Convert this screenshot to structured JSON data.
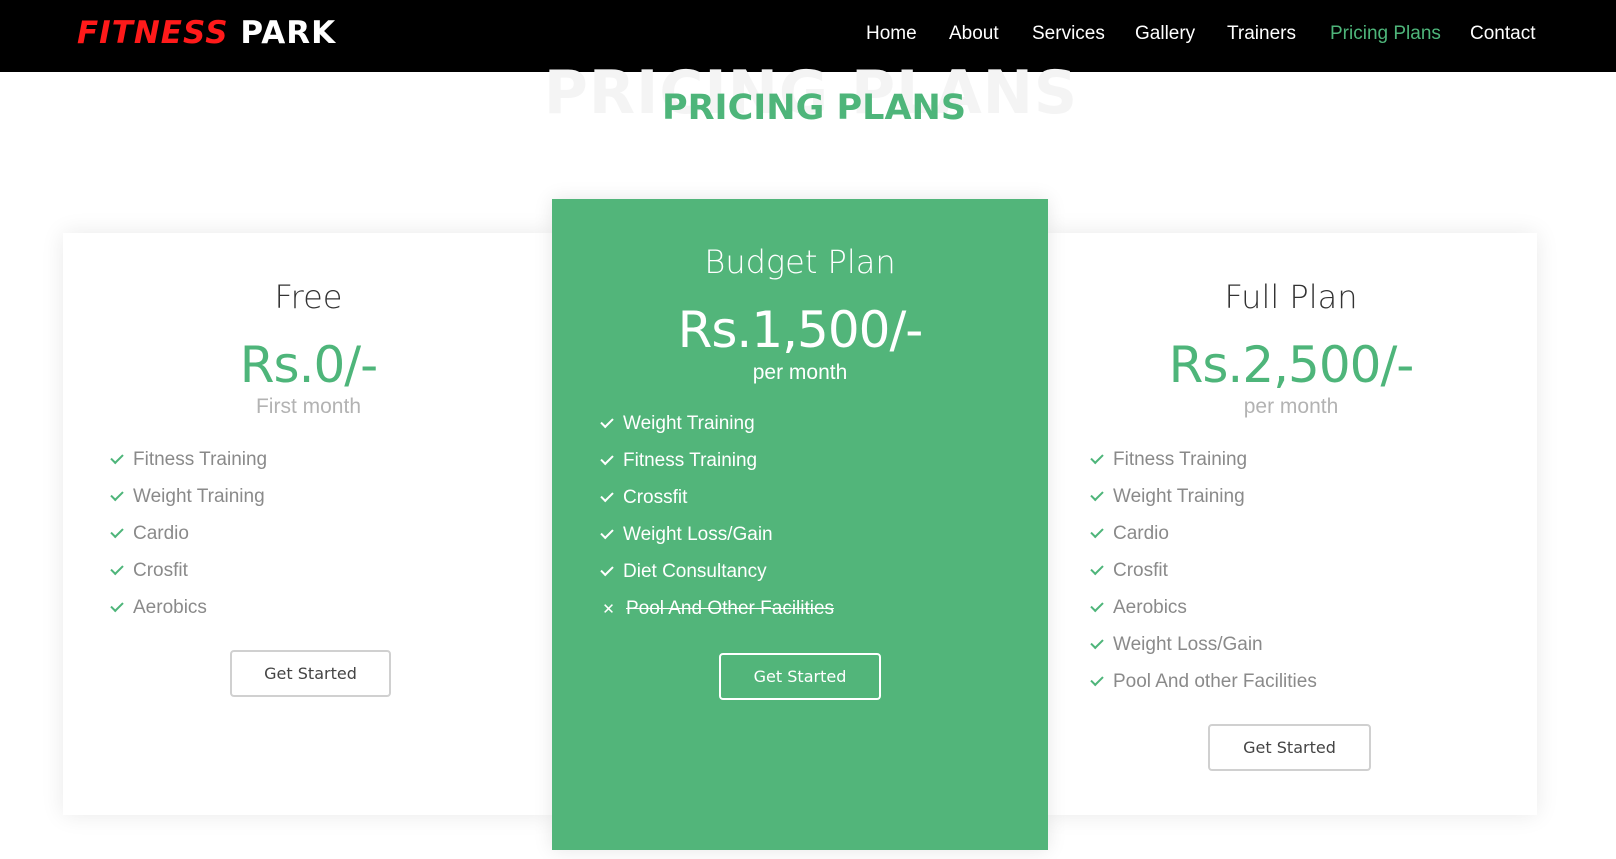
{
  "header": {
    "brand_part1": "FITNESS",
    "brand_part2": "PARK",
    "nav": [
      {
        "label": "Home"
      },
      {
        "label": "About"
      },
      {
        "label": "Services"
      },
      {
        "label": "Gallery"
      },
      {
        "label": "Trainers"
      },
      {
        "label": "Pricing Plans",
        "active": true
      },
      {
        "label": "Contact"
      }
    ]
  },
  "section": {
    "ghost_title": "PRICING PLANS",
    "title": "PRICING PLANS"
  },
  "plans": [
    {
      "name": "Free",
      "price": "Rs.0/-",
      "period": "First month",
      "features": [
        {
          "text": "Fitness Training",
          "icon": "check-icon"
        },
        {
          "text": "Weight Training",
          "icon": "check-icon"
        },
        {
          "text": "Cardio",
          "icon": "check-icon"
        },
        {
          "text": "Crosfit",
          "icon": "check-icon"
        },
        {
          "text": "Aerobics",
          "icon": "check-icon"
        }
      ],
      "button": "Get Started"
    },
    {
      "name": "Budget Plan",
      "price": "Rs.1,500/-",
      "period": "per month",
      "features": [
        {
          "text": "Weight Training",
          "icon": "check-icon"
        },
        {
          "text": "Fitness Training",
          "icon": "check-icon"
        },
        {
          "text": "Crossfit",
          "icon": "check-icon"
        },
        {
          "text": "Weight Loss/Gain",
          "icon": "check-icon"
        },
        {
          "text": "Diet Consultancy",
          "icon": "check-icon"
        },
        {
          "text": "Pool And Other Facilities",
          "icon": "cross-icon",
          "disabled": true
        }
      ],
      "button": "Get Started",
      "highlighted": true
    },
    {
      "name": "Full Plan",
      "price": "Rs.2,500/-",
      "period": "per month",
      "features": [
        {
          "text": "Fitness Training",
          "icon": "check-icon"
        },
        {
          "text": "Weight Training",
          "icon": "check-icon"
        },
        {
          "text": "Cardio",
          "icon": "check-icon"
        },
        {
          "text": "Crosfit",
          "icon": "check-icon"
        },
        {
          "text": "Aerobics",
          "icon": "check-icon"
        },
        {
          "text": "Weight Loss/Gain",
          "icon": "check-icon"
        },
        {
          "text": "Pool And other Facilities",
          "icon": "check-icon"
        }
      ],
      "button": "Get Started"
    }
  ],
  "colors": {
    "accent": "#4eb57a",
    "highlight_card": "#52b57a",
    "brand_red": "#ff1a1a",
    "navbar": "#000000"
  }
}
